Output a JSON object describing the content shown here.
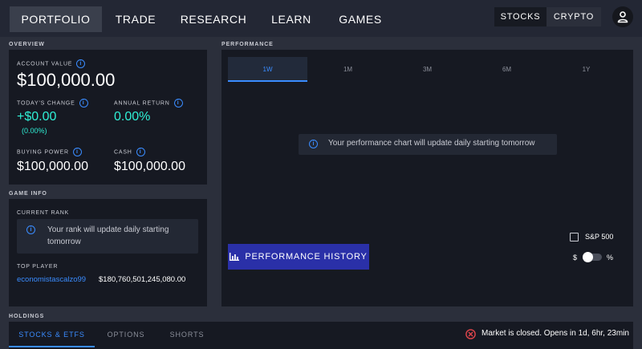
{
  "nav": {
    "tabs": [
      "PORTFOLIO",
      "TRADE",
      "RESEARCH",
      "LEARN",
      "GAMES"
    ],
    "active_tab": "PORTFOLIO",
    "asset_toggle": [
      "STOCKS",
      "CRYPTO"
    ],
    "active_asset": "STOCKS",
    "user_icon": "user-icon"
  },
  "overview": {
    "section_label": "OVERVIEW",
    "account_value_label": "ACCOUNT VALUE",
    "account_value": "$100,000.00",
    "todays_change_label": "TODAY'S CHANGE",
    "todays_change": "+$0.00",
    "todays_change_pct": "(0.00%)",
    "annual_return_label": "ANNUAL RETURN",
    "annual_return": "0.00%",
    "buying_power_label": "BUYING POWER",
    "buying_power": "$100,000.00",
    "cash_label": "CASH",
    "cash": "$100,000.00"
  },
  "game_info": {
    "section_label": "GAME INFO",
    "current_rank_label": "CURRENT RANK",
    "rank_notice": "Your rank will update daily starting tomorrow",
    "top_player_label": "TOP PLAYER",
    "top_player_name": "economistascalzo99",
    "top_player_value": "$180,760,501,245,080.00"
  },
  "performance": {
    "section_label": "PERFORMANCE",
    "ranges": [
      "1W",
      "1M",
      "3M",
      "6M",
      "1Y"
    ],
    "active_range": "1W",
    "notice": "Your performance chart will update daily starting tomorrow",
    "history_button": "PERFORMANCE HISTORY",
    "benchmark_label": "S&P 500",
    "benchmark_checked": false,
    "toggle_left": "$",
    "toggle_right": "%",
    "toggle_state": "$"
  },
  "holdings": {
    "section_label": "HOLDINGS",
    "tabs": [
      "STOCKS & ETFS",
      "OPTIONS",
      "SHORTS"
    ],
    "active_tab": "STOCKS & ETFS",
    "market_status": "Market is closed. Opens in 1d, 6hr, 23min"
  },
  "colors": {
    "accent_blue": "#3a8cff",
    "positive_teal": "#2ff0d6",
    "button_indigo": "#2a30a8",
    "market_closed_red": "#e0454b"
  }
}
